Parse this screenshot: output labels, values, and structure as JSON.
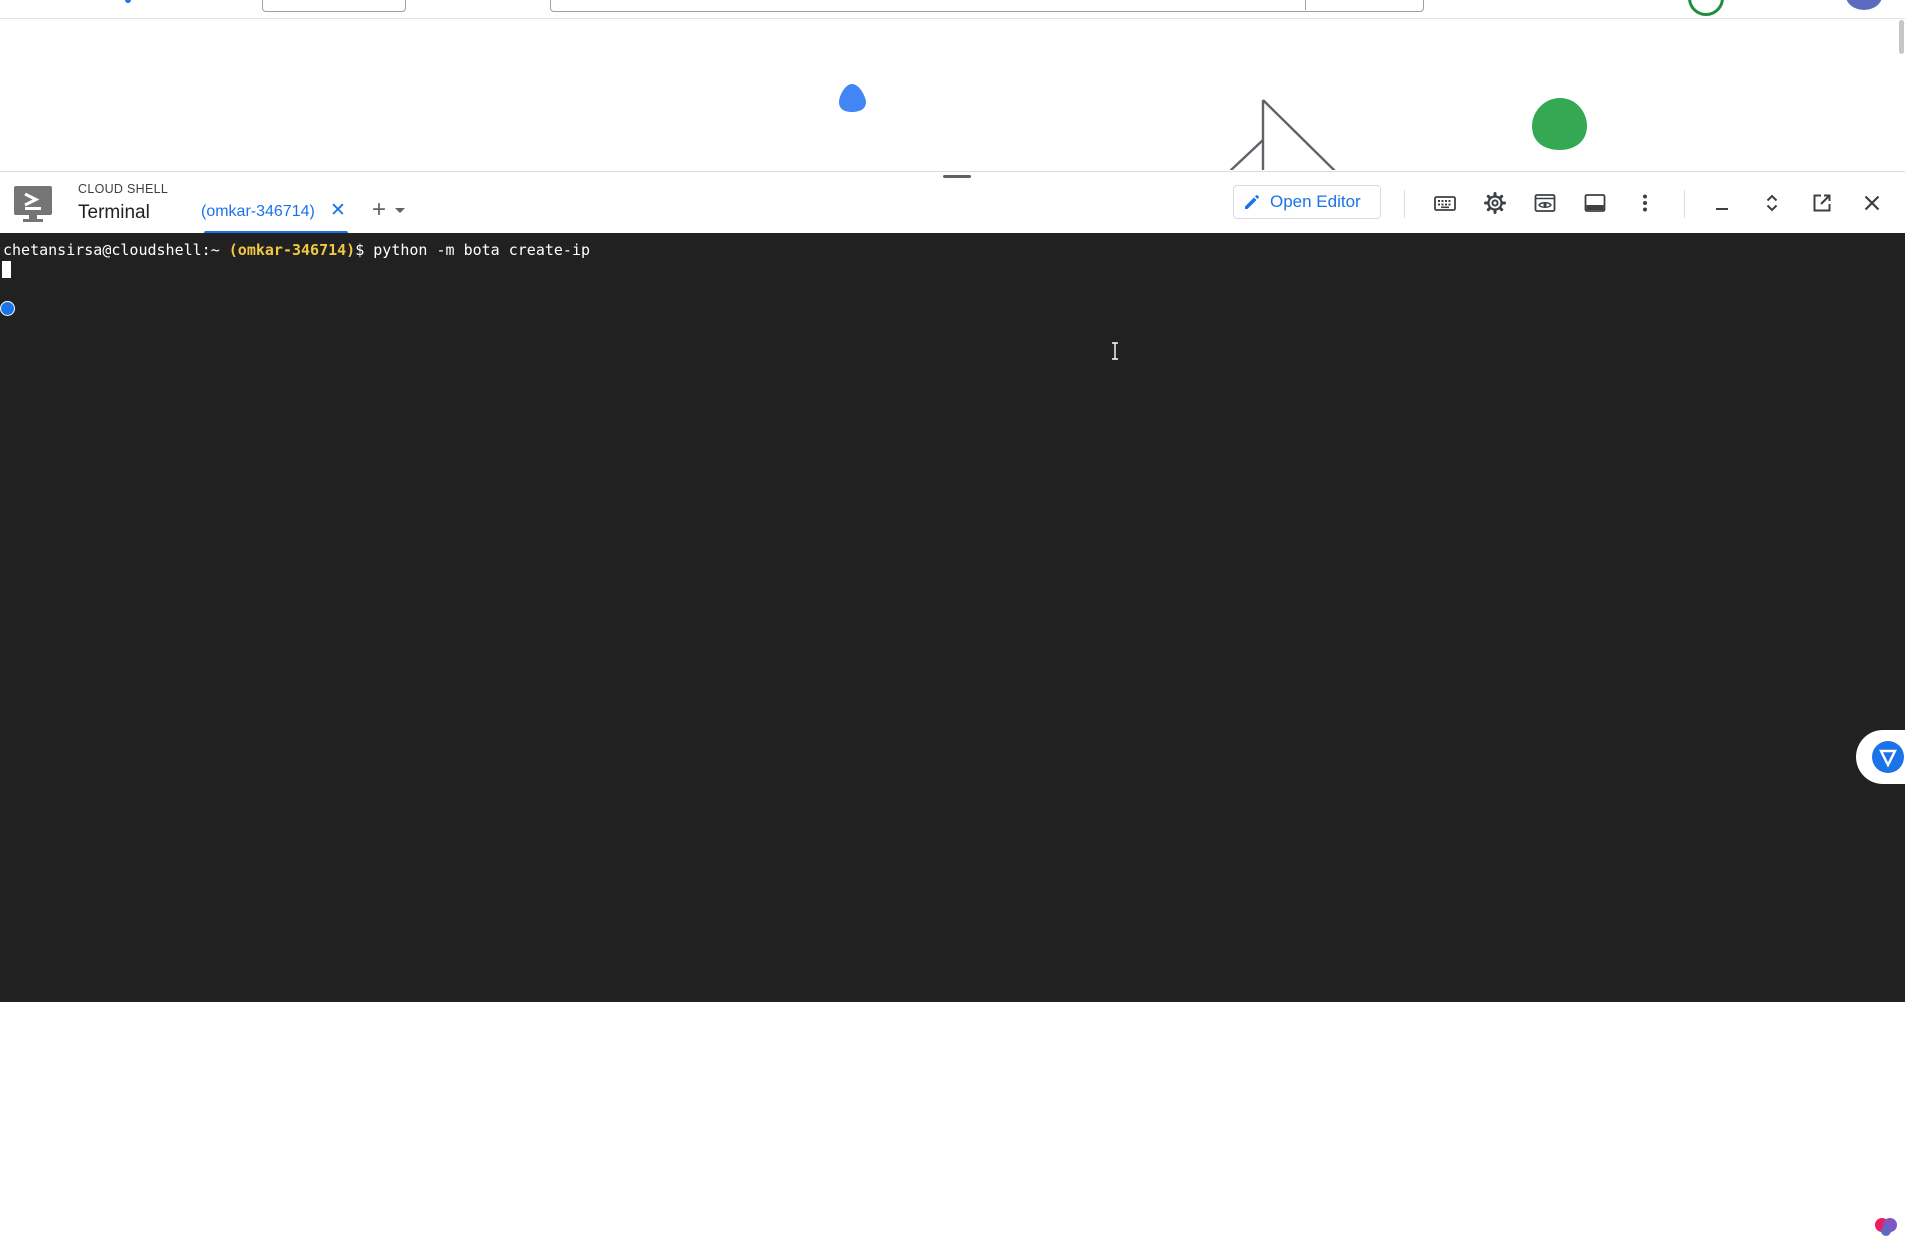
{
  "cloud_shell": {
    "label": "CLOUD SHELL",
    "panel_title": "Terminal",
    "active_tab": {
      "label": "(omkar-346714)"
    },
    "open_editor_label": "Open Editor"
  },
  "terminal": {
    "prompt_user_host": "chetansirsa@cloudshell:~",
    "prompt_project": "(omkar-346714)",
    "prompt_symbol": "$",
    "command": "python -m bota create-ip"
  },
  "colors": {
    "accent": "#1a73e8",
    "terminal_bg": "#212121",
    "prompt_project": "#f2c744",
    "illustration_blue": "#4285f4",
    "illustration_green": "#34a853"
  },
  "icons": {
    "shell_logo": "cloud-shell-icon",
    "close_tab": "close-icon",
    "add_tab": "plus-icon",
    "tab_menu": "chevron-down-icon",
    "open_editor": "pencil-icon",
    "keyboard": "keyboard-icon",
    "settings": "gear-icon",
    "web_preview": "web-preview-icon",
    "dock": "dock-panel-icon",
    "more": "more-vert-icon",
    "minimize": "minimize-icon",
    "maximize": "unfold-icon",
    "open_new_window": "open-in-new-icon",
    "close": "close-icon"
  }
}
